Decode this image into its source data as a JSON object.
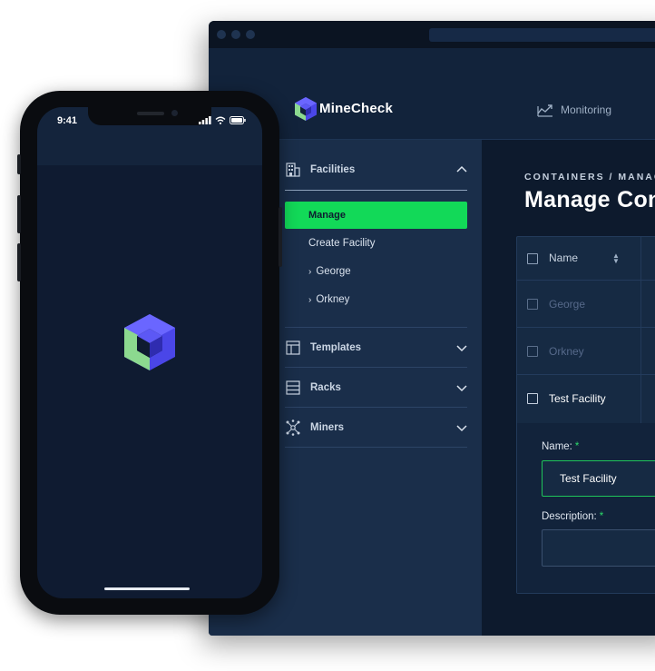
{
  "app": {
    "brand": "MineCheck",
    "nav_monitoring": "Monitoring"
  },
  "sidebar": {
    "sections": [
      {
        "label": "Facilities",
        "icon": "building-icon",
        "expanded": true
      },
      {
        "label": "Templates",
        "icon": "template-icon",
        "expanded": false
      },
      {
        "label": "Racks",
        "icon": "rack-icon",
        "expanded": false
      },
      {
        "label": "Miners",
        "icon": "network-icon",
        "expanded": false
      }
    ],
    "facilities_items": {
      "manage": "Manage",
      "create": "Create Facility",
      "sub": [
        "George",
        "Orkney"
      ]
    }
  },
  "main": {
    "breadcrumb": "CONTAINERS / MANAGE",
    "title": "Manage Containers",
    "table": {
      "header_name": "Name",
      "rows": [
        "George",
        "Orkney",
        "Test Facility"
      ]
    },
    "form": {
      "name_label": "Name:",
      "name_required": "*",
      "name_value": "Test Facility",
      "description_label": "Description:",
      "description_required": "*"
    }
  },
  "phone": {
    "time": "9:41"
  },
  "colors": {
    "accent_green": "#12d958",
    "sidebar_bg": "#1a2e4a",
    "main_bg": "#0d1a2d",
    "header_bg": "#12233b"
  }
}
